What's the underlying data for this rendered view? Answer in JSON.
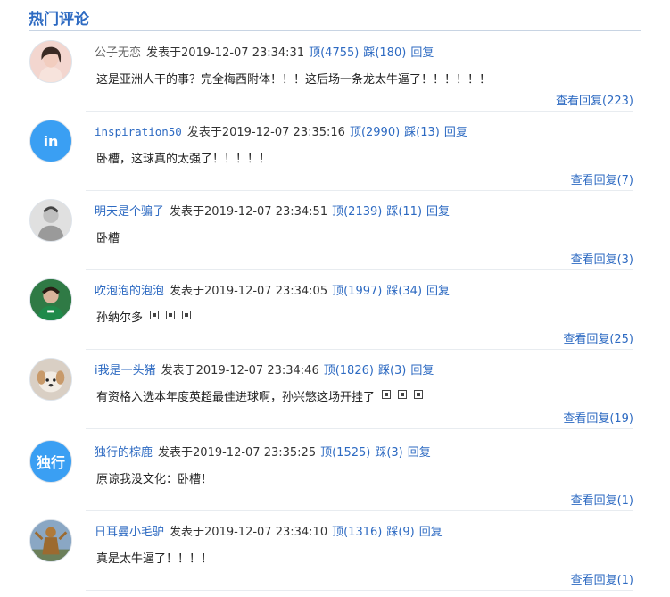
{
  "section": {
    "title": "热门评论"
  },
  "labels": {
    "posted": "发表于",
    "reply": "回复"
  },
  "comments": [
    {
      "user": "公子无恋",
      "user_style": "gray",
      "time": "2019-12-07 23:34:31",
      "up": "顶(4755)",
      "down": "踩(180)",
      "text": "这是亚洲人干的事？完全梅西附体！！！这后场一条龙太牛逼了！！！！！！",
      "view_replies": "查看回复(223)",
      "avatar": {
        "type": "photo",
        "icon": "woman-portrait",
        "bg": "#f3d6cf"
      }
    },
    {
      "user": "inspiration50",
      "user_style": "mono",
      "time": "2019-12-07 23:35:16",
      "up": "顶(2990)",
      "down": "踩(13)",
      "text": "卧槽，这球真的太强了！！！！！",
      "view_replies": "查看回复(7)",
      "avatar": {
        "type": "text",
        "text": "in",
        "bg": "#3a9ff3"
      }
    },
    {
      "user": "明天是个骗子",
      "user_style": "",
      "time": "2019-12-07 23:34:51",
      "up": "顶(2139)",
      "down": "踩(11)",
      "text": "卧槽",
      "view_replies": "查看回复(3)",
      "avatar": {
        "type": "photo",
        "icon": "sketch-portrait",
        "bg": "#e0e0e0"
      }
    },
    {
      "user": "吹泡泡的泡泡",
      "user_style": "",
      "time": "2019-12-07 23:34:05",
      "up": "顶(1997)",
      "down": "踩(34)",
      "text": "孙纳尔多",
      "emojis": 3,
      "view_replies": "查看回复(25)",
      "avatar": {
        "type": "photo",
        "icon": "footballer-portrait",
        "bg": "#2f7a45"
      }
    },
    {
      "user": "i我是一头猪",
      "user_style": "",
      "time": "2019-12-07 23:34:46",
      "up": "顶(1826)",
      "down": "踩(3)",
      "text": "有资格入选本年度英超最佳进球啊，孙兴慜这场开挂了",
      "emojis": 3,
      "view_replies": "查看回复(19)",
      "avatar": {
        "type": "photo",
        "icon": "puppy-portrait",
        "bg": "#d9cfc4"
      }
    },
    {
      "user": "独行的棕鹿",
      "user_style": "",
      "time": "2019-12-07 23:35:25",
      "up": "顶(1525)",
      "down": "踩(3)",
      "text": "原谅我没文化：卧槽！",
      "view_replies": "查看回复(1)",
      "avatar": {
        "type": "text",
        "text": "独行",
        "bg": "#3a9ff3"
      }
    },
    {
      "user": "日耳曼小毛驴",
      "user_style": "",
      "time": "2019-12-07 23:34:10",
      "up": "顶(1316)",
      "down": "踩(9)",
      "text": "真是太牛逼了！！！！",
      "view_replies": "查看回复(1)",
      "avatar": {
        "type": "photo",
        "icon": "statue-portrait",
        "bg": "#8aa7c4"
      }
    }
  ]
}
